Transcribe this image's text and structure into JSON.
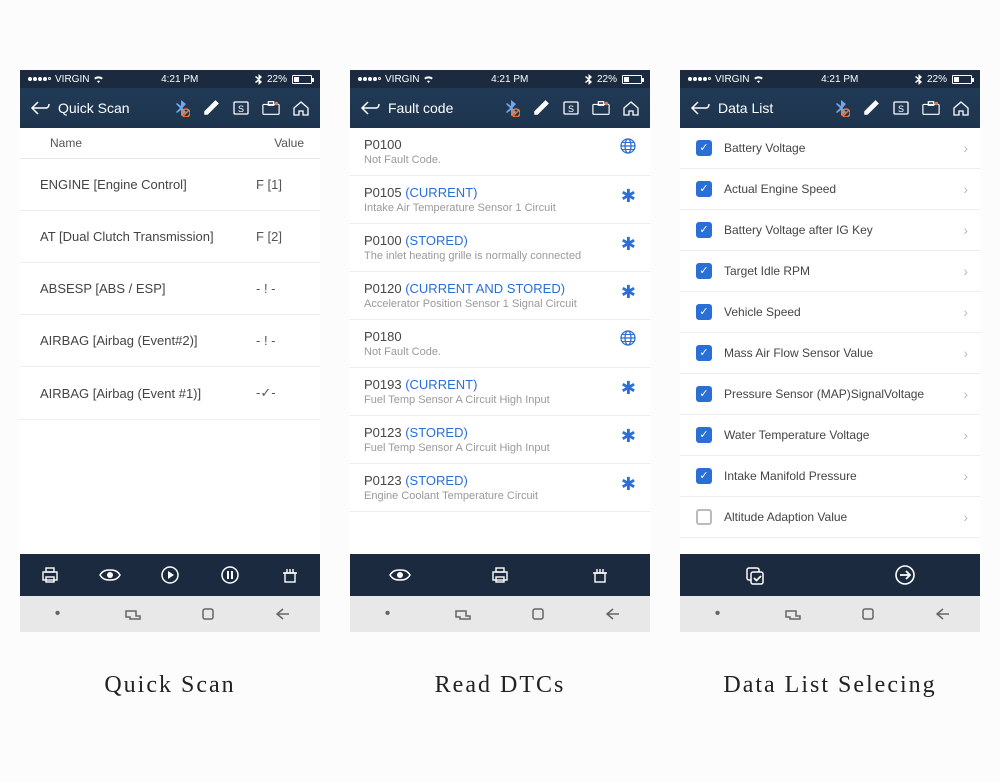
{
  "status": {
    "carrier": "VIRGIN",
    "time": "4:21 PM",
    "battery": "22%"
  },
  "screens": [
    {
      "title": "Quick Scan",
      "caption": "Quick Scan",
      "header": {
        "c1": "Name",
        "c2": "Value"
      },
      "rows": [
        {
          "name": "ENGINE [Engine Control]",
          "value": "F [1]"
        },
        {
          "name": "AT [Dual Clutch Transmission]",
          "value": "F [2]"
        },
        {
          "name": "ABSESP [ABS / ESP]",
          "value": "- ! -"
        },
        {
          "name": "AIRBAG [Airbag (Event#2)]",
          "value": "- ! -"
        },
        {
          "name": "AIRBAG [Airbag (Event #1)]",
          "value": "-✓-"
        }
      ]
    },
    {
      "title": "Fault code",
      "caption": "Read DTCs",
      "rows": [
        {
          "code": "P0100",
          "tag": "",
          "desc": "Not Fault Code.",
          "icon": "globe"
        },
        {
          "code": "P0105",
          "tag": " (CURRENT)",
          "desc": "Intake Air Temperature Sensor 1 Circuit",
          "icon": "snow"
        },
        {
          "code": "P0100",
          "tag": " (STORED)",
          "desc": "The inlet heating grille is normally connected",
          "icon": "snow"
        },
        {
          "code": "P0120",
          "tag": " (CURRENT AND STORED)",
          "desc": "Accelerator Position Sensor 1 Signal Circuit",
          "icon": "snow"
        },
        {
          "code": "P0180",
          "tag": "",
          "desc": "Not Fault Code.",
          "icon": "globe"
        },
        {
          "code": "P0193",
          "tag": " (CURRENT)",
          "desc": "Fuel Temp Sensor A Circuit High Input",
          "icon": "snow"
        },
        {
          "code": "P0123",
          "tag": " (STORED)",
          "desc": "Fuel Temp Sensor A Circuit High Input",
          "icon": "snow"
        },
        {
          "code": "P0123",
          "tag": " (STORED)",
          "desc": "Engine Coolant Temperature Circuit",
          "icon": "snow"
        }
      ]
    },
    {
      "title": "Data List",
      "caption": "Data List Selecing",
      "rows": [
        {
          "label": "Battery Voltage",
          "checked": true
        },
        {
          "label": "Actual Engine Speed",
          "checked": true
        },
        {
          "label": "Battery Voltage after IG Key",
          "checked": true
        },
        {
          "label": "Target Idle RPM",
          "checked": true
        },
        {
          "label": "Vehicle Speed",
          "checked": true
        },
        {
          "label": "Mass Air Flow Sensor Value",
          "checked": true
        },
        {
          "label": "Pressure Sensor (MAP)SignalVoltage",
          "checked": true
        },
        {
          "label": "Water Temperature Voltage",
          "checked": true
        },
        {
          "label": "Intake Manifold Pressure",
          "checked": true
        },
        {
          "label": "Altitude Adaption Value",
          "checked": false
        }
      ]
    }
  ]
}
